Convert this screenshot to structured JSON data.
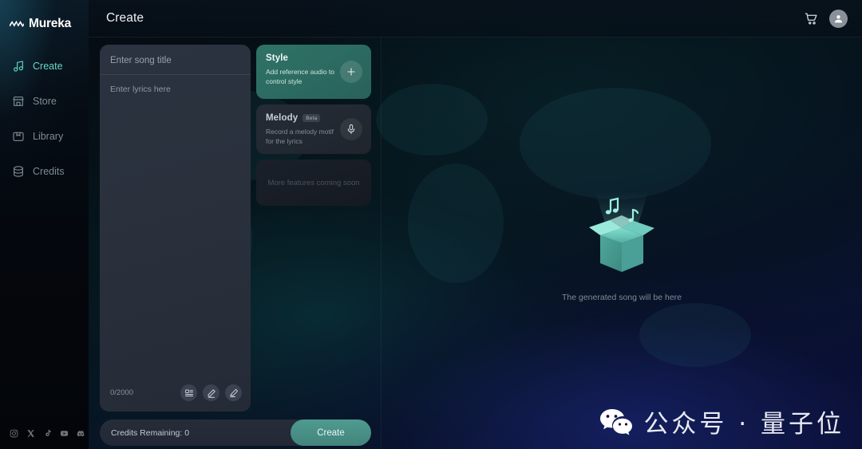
{
  "brand": {
    "name": "Mureka",
    "logo_icon": "waveform-logo-icon"
  },
  "sidebar": {
    "items": [
      {
        "label": "Create",
        "icon": "music-note-icon",
        "active": true
      },
      {
        "label": "Store",
        "icon": "store-icon",
        "active": false
      },
      {
        "label": "Library",
        "icon": "library-icon",
        "active": false
      },
      {
        "label": "Credits",
        "icon": "database-icon",
        "active": false
      }
    ],
    "socials": [
      "instagram-icon",
      "x-twitter-icon",
      "tiktok-icon",
      "youtube-icon",
      "discord-icon"
    ]
  },
  "header": {
    "title": "Create",
    "cart_icon": "shopping-cart-icon",
    "avatar_icon": "user-avatar-icon"
  },
  "editor": {
    "title_placeholder": "Enter song title",
    "lyrics_placeholder": "Enter lyrics here",
    "char_count": "0/2000",
    "tools": [
      {
        "name": "lyrics-template-button",
        "icon": "lyrics-list-icon"
      },
      {
        "name": "write-lyrics-button",
        "icon": "pencil-icon"
      },
      {
        "name": "edit-lyrics-button",
        "icon": "pencil-lines-icon"
      }
    ]
  },
  "features": {
    "style": {
      "title": "Style",
      "subtitle": "Add reference audio to control style",
      "action_icon": "plus-icon",
      "accent": "#2f7266"
    },
    "melody": {
      "title": "Melody",
      "badge": "Beta",
      "subtitle": "Record a melody motif for the lyrics",
      "action_icon": "microphone-icon"
    },
    "coming_soon": "More features coming soon"
  },
  "footer_bar": {
    "credits_label": "Credits Remaining: 0",
    "create_label": "Create",
    "create_accent": "#4f9b91"
  },
  "result": {
    "caption": "The generated song will be here",
    "illustration": "open-box-with-music-notes-icon",
    "box_color": "#7fded0"
  },
  "watermark": {
    "icon": "wechat-icon",
    "text": "公众号 · 量子位"
  }
}
